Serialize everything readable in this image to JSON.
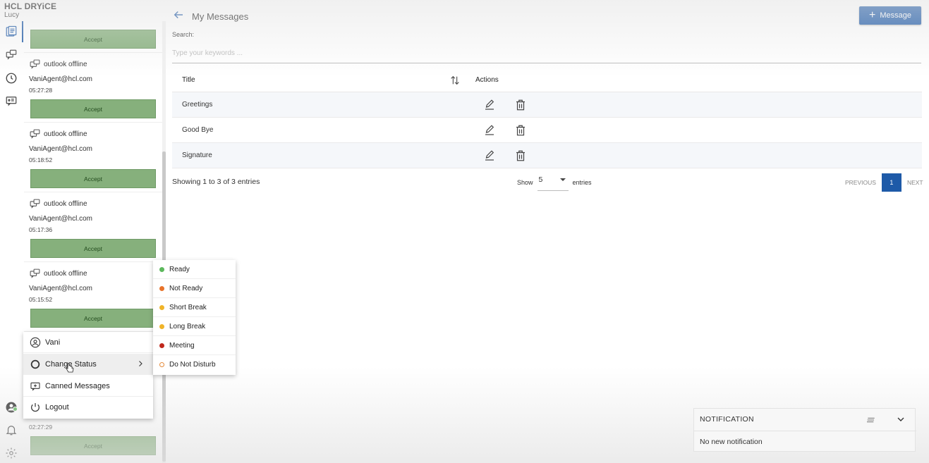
{
  "brand": {
    "logo": "HCL DRYiCE",
    "user": "Lucy"
  },
  "colors": {
    "primary": "#1e5aa8",
    "accept": "#86b07c"
  },
  "rail": {
    "icons": [
      "message-list-icon",
      "chat-icon",
      "history-clock-icon",
      "canned-message-icon"
    ],
    "bottom_icons": [
      "agent-avatar-icon",
      "bell-icon",
      "settings-gear-icon"
    ]
  },
  "chats": [
    {
      "channel": "",
      "email": "",
      "time": "",
      "accept": "Accept"
    },
    {
      "channel": "outlook offline",
      "email": "VaniAgent@hcl.com",
      "time": "05:27:28",
      "accept": "Accept"
    },
    {
      "channel": "outlook offline",
      "email": "VaniAgent@hcl.com",
      "time": "05:18:52",
      "accept": "Accept"
    },
    {
      "channel": "outlook offline",
      "email": "VaniAgent@hcl.com",
      "time": "05:17:36",
      "accept": "Accept"
    },
    {
      "channel": "outlook offline",
      "email": "VaniAgent@hcl.com",
      "time": "05:15:52",
      "accept": "Accept"
    },
    {
      "channel": "",
      "email": "",
      "time": "02:27:29",
      "accept": "Accept"
    }
  ],
  "header": {
    "title": "My Messages",
    "new_button": "Message",
    "back_icon": "arrow-left-icon"
  },
  "search": {
    "label": "Search:",
    "placeholder": "Type your keywords ..."
  },
  "table": {
    "headers": {
      "title": "Title",
      "actions": "Actions"
    },
    "rows": [
      {
        "title": "Greetings"
      },
      {
        "title": "Good Bye"
      },
      {
        "title": "Signature"
      }
    ]
  },
  "footer": {
    "showing": "Showing 1 to 3 of 3 entries",
    "show_label": "Show",
    "show_value": "5",
    "entries_label": "entries",
    "previous": "PREVIOUS",
    "current_page": "1",
    "next": "NEXT"
  },
  "profile_menu": {
    "items": [
      {
        "label": "Vani",
        "icon": "user-circle-icon"
      },
      {
        "label": "Change Status",
        "icon": "status-circle-icon"
      },
      {
        "label": "Canned Messages",
        "icon": "canned-message-icon"
      },
      {
        "label": "Logout",
        "icon": "power-icon"
      }
    ]
  },
  "status_menu": {
    "items": [
      {
        "label": "Ready",
        "color": "#5cb85c"
      },
      {
        "label": "Not Ready",
        "color": "#e8732a"
      },
      {
        "label": "Short Break",
        "color": "#f0b429"
      },
      {
        "label": "Long Break",
        "color": "#f0b429"
      },
      {
        "label": "Meeting",
        "color": "#c0281c"
      },
      {
        "label": "Do Not Disturb",
        "color": "#e58a3a"
      }
    ]
  },
  "notification": {
    "title": "NOTIFICATION",
    "empty": "No new notification"
  }
}
